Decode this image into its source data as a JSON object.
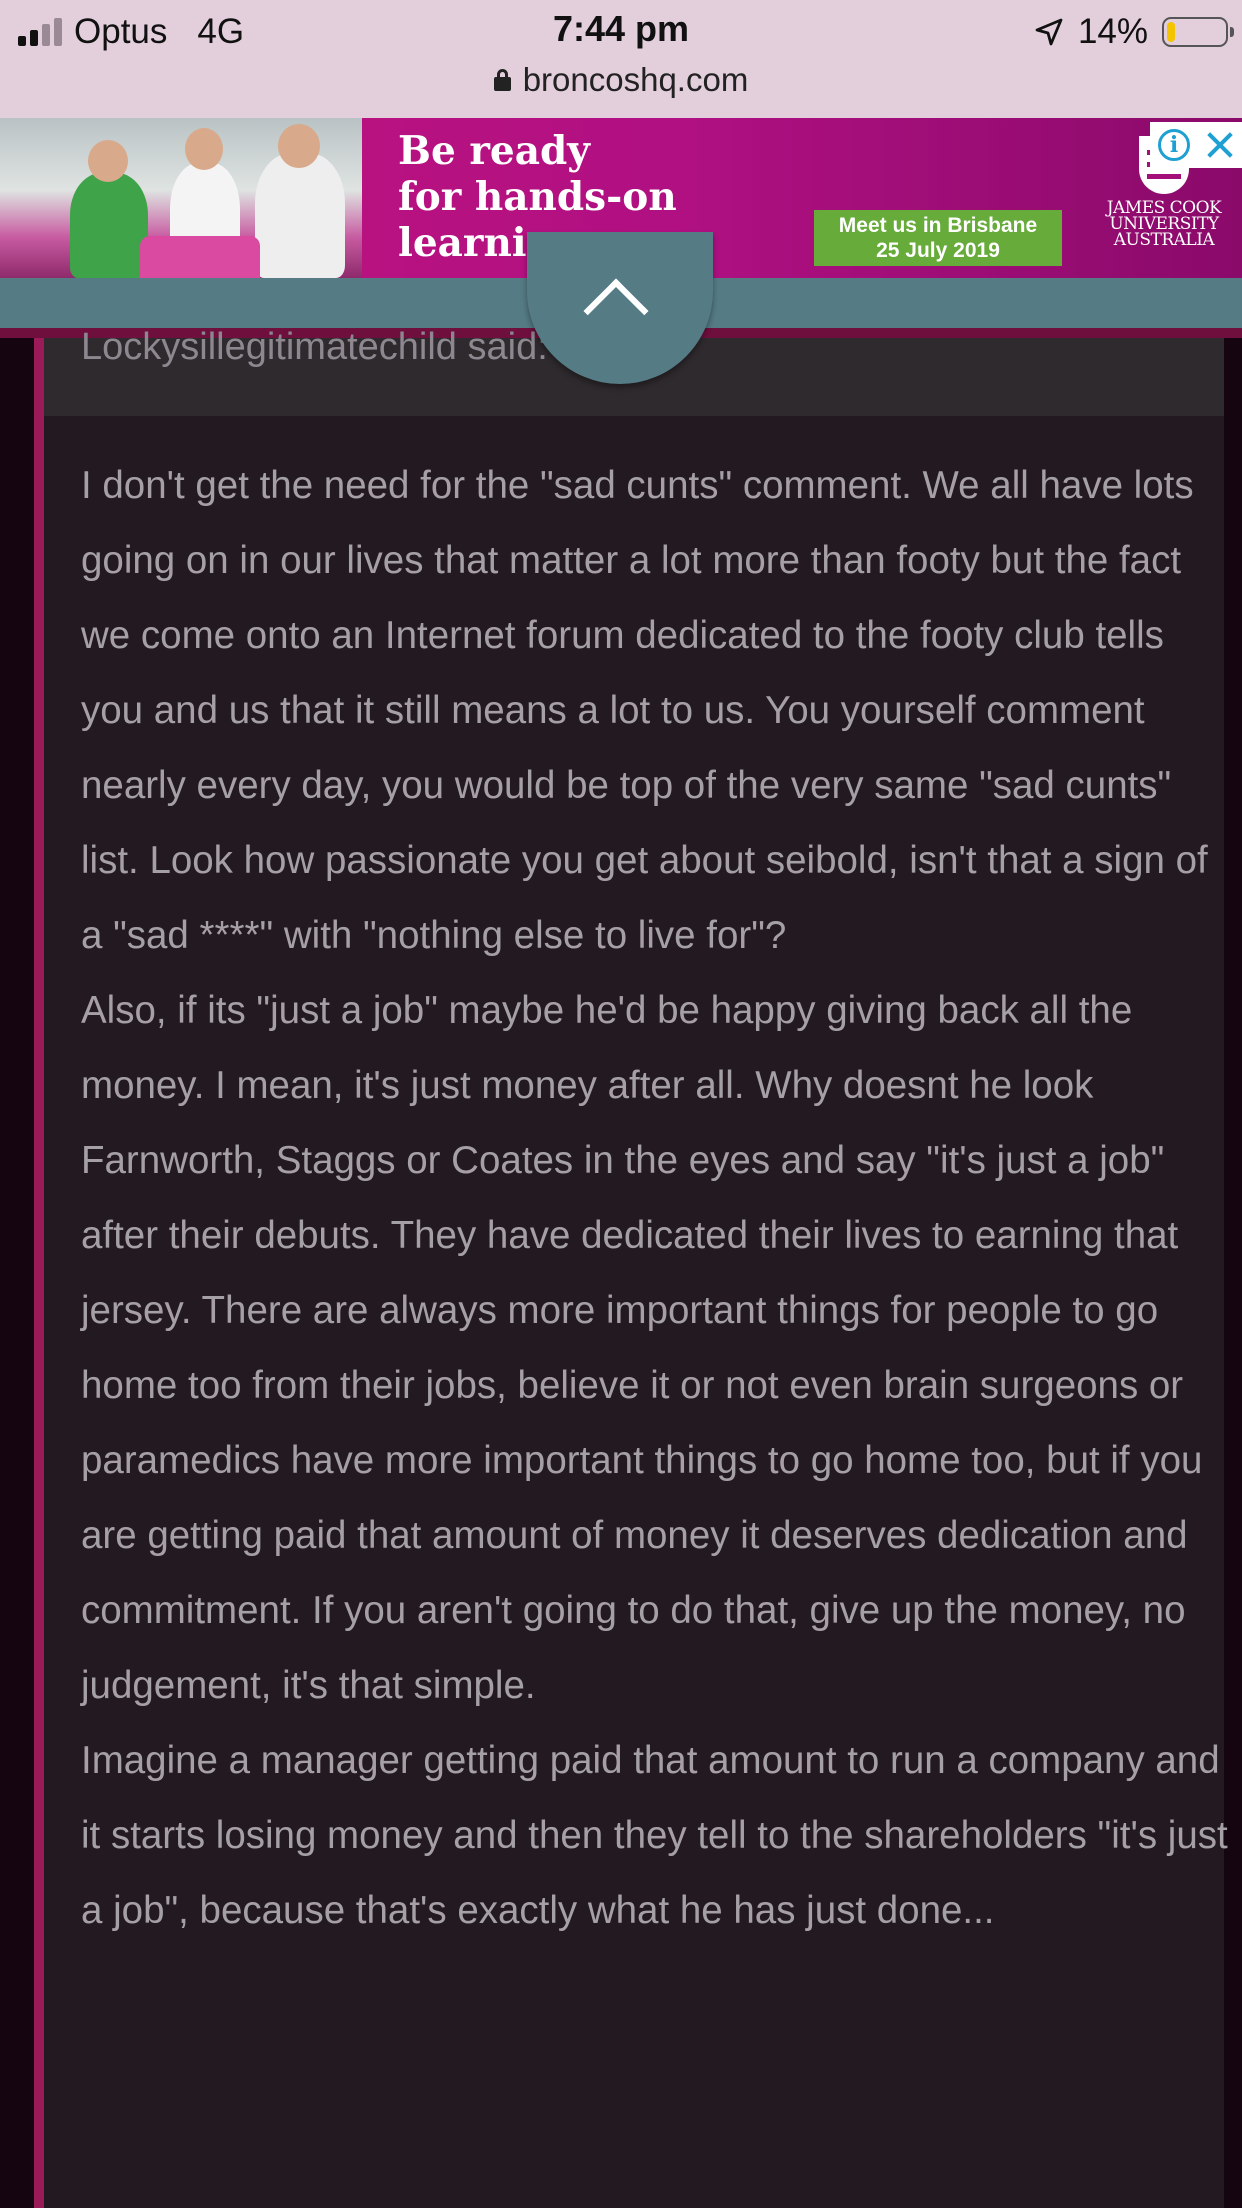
{
  "status_bar": {
    "carrier": "Optus",
    "network": "4G",
    "time": "7:44 pm",
    "battery_percent": "14%",
    "battery_level": 0.14,
    "signal_bars_active": 2,
    "signal_bars_total": 4,
    "url": "broncoshq.com"
  },
  "ad": {
    "headline": "Be ready\nfor hands-on\nlearning",
    "cta": "Meet us in Brisbane\n25 July 2019",
    "brand": "JAMES COOK\nUNIVERSITY\nAUSTRALIA",
    "icons": [
      "adchoices-info-icon",
      "close-icon"
    ],
    "colors": {
      "background": "#b01082",
      "cta": "#67ab3a",
      "adchoices": "#1ea0d2"
    }
  },
  "post": {
    "quote_author_line": "Lockysillegitimatechild said:",
    "paragraphs": [
      "I don't get the need for the \"sad cunts\" comment. We all have lots going on in our lives that matter a lot more than footy but the fact we come onto an Internet forum dedicated to the footy club tells you and us that it still means a lot to us. You yourself comment nearly every day, you would be top of the very same \"sad cunts\" list. Look how passionate you get about seibold, isn't that a sign of a \"sad ****\" with \"nothing else to live for\"?",
      "Also, if its \"just a job\" maybe he'd be happy giving back all the money. I mean, it's just money after all. Why doesnt he look Farnworth, Staggs or Coates in the eyes and say \"it's just a job\" after their debuts. They have dedicated their lives to earning that jersey. There are always more important things for people to go home too from their jobs, believe it or not even brain surgeons or paramedics have more important things to go home too, but if you are getting paid that amount of money it deserves dedication and commitment. If you aren't going to do that, give up the money, no judgement, it's that simple.",
      "Imagine a manager getting paid that amount to run a company and it starts losing money and then they tell to the shareholders \"it's just a job\", because that's exactly what he has just done..."
    ]
  },
  "controls": {
    "scroll_top_icon": "chevron-up-icon"
  },
  "theme": {
    "accent": "#9b1b58",
    "toolbar": "#557b85",
    "post_bg": "#231a21",
    "text": "#a59fa6"
  }
}
